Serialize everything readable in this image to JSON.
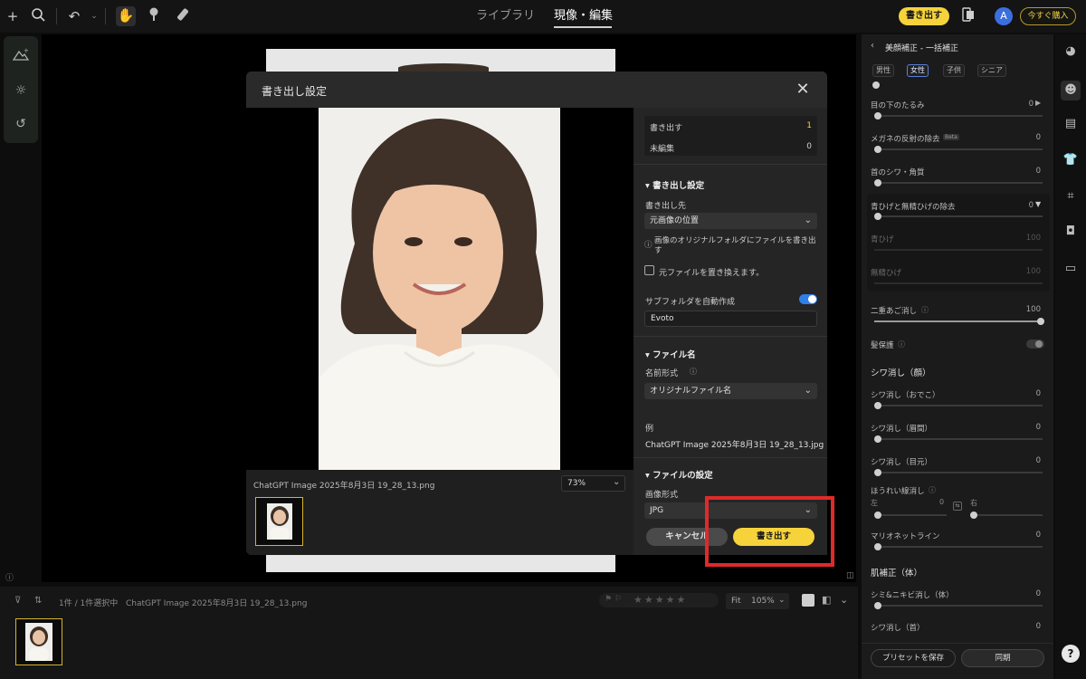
{
  "topbar": {
    "nav_library": "ライブラリ",
    "nav_develop": "現像・編集",
    "export_button": "書き出す",
    "avatar_letter": "A",
    "buy_button": "今すぐ購入"
  },
  "modal": {
    "title": "書き出し設定",
    "summary": [
      {
        "label": "書き出す",
        "value": "1"
      },
      {
        "label": "未編集",
        "value": "0"
      }
    ],
    "export_settings_header": "書き出し設定",
    "destination_label": "書き出し先",
    "destination_value": "元画像の位置",
    "destination_info": "画像のオリジナルフォルダにファイルを書き出す",
    "overwrite_label": "元ファイルを置き換えます。",
    "subfolder_label": "サブフォルダを自動作成",
    "subfolder_value": "Evoto",
    "filename_header": "ファイル名",
    "name_format_label": "名前形式",
    "name_format_value": "オリジナルファイル名",
    "example_label": "例",
    "example_value": "ChatGPT Image 2025年8月3日 19_28_13.jpg",
    "file_settings_header": "ファイルの設定",
    "image_format_label": "画像形式",
    "image_format_value": "JPG",
    "cancel_button": "キャンセル",
    "export_button": "書き出す",
    "preview_filename": "ChatGPT Image 2025年8月3日 19_28_13.png",
    "zoom_value": "73%"
  },
  "bottombar": {
    "selection_text": "1件 / 1件選択中",
    "filename": "ChatGPT Image 2025年8月3日 19_28_13.png",
    "fit_label": "Fit",
    "zoom_value": "105%"
  },
  "rightpanel": {
    "title": "美顔補正 - 一括補正",
    "chips": [
      "男性",
      "女性",
      "子供",
      "シニア"
    ],
    "items": [
      {
        "label": "目の下のたるみ",
        "value": "0"
      },
      {
        "label": "メガネの反射の除去",
        "value": "0",
        "badge": "Beta"
      },
      {
        "label": "首のシワ・角質",
        "value": "0"
      },
      {
        "label": "青ひげと無精ひげの除去",
        "value": "0"
      },
      {
        "label": "青ひげ",
        "value": "100"
      },
      {
        "label": "無精ひげ",
        "value": "100"
      },
      {
        "label": "二重あご消し",
        "value": "100"
      },
      {
        "label": "髪保護",
        "value": ""
      },
      {
        "label": "シワ消し（おでこ）",
        "value": "0"
      },
      {
        "label": "シワ消し（眉間）",
        "value": "0"
      },
      {
        "label": "シワ消し（目元）",
        "value": "0"
      },
      {
        "label": "ほうれい線消し",
        "value": ""
      },
      {
        "label": "マリオネットライン",
        "value": "0"
      },
      {
        "label": "シミ&ニキビ消し（体）",
        "value": "0"
      },
      {
        "label": "シワ消し（首）",
        "value": "0"
      }
    ],
    "nasolabial_left": "左",
    "nasolabial_left_value": "0",
    "nasolabial_right": "右",
    "section_wrinkle": "シワ消し（顔）",
    "section_skin": "肌補正（体）",
    "save_preset": "プリセットを保存",
    "sync": "同期",
    "help": "?"
  },
  "colors": {
    "accent_yellow": "#f6d33b",
    "toggle_blue": "#2f7fe8",
    "highlight_red": "#e02a2a"
  }
}
